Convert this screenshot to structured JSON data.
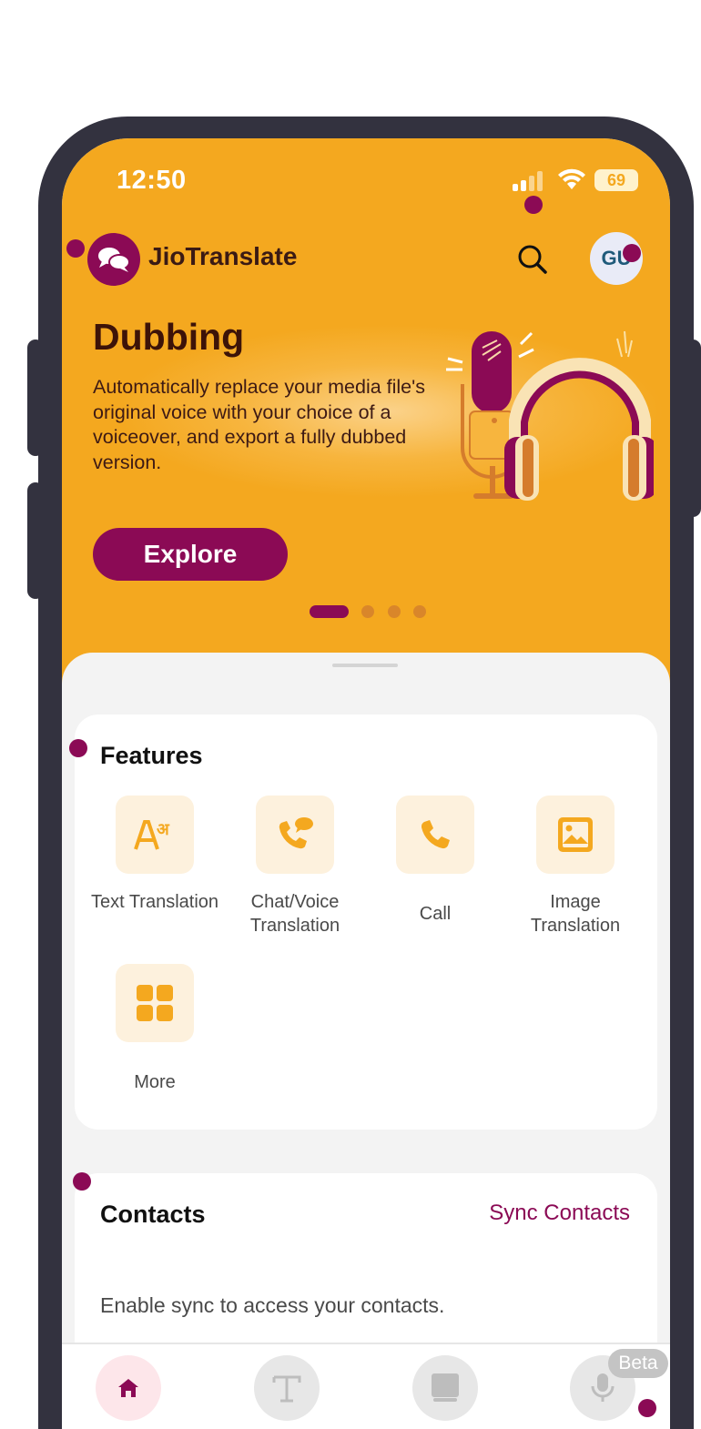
{
  "status_bar": {
    "time": "12:50",
    "battery": "69"
  },
  "header": {
    "app_name": "JioTranslate",
    "avatar_initials": "GU"
  },
  "hero": {
    "title": "Dubbing",
    "description": "Automatically replace your media file's original voice with your choice of a voiceover, and export a fully dubbed version.",
    "cta": "Explore",
    "carousel_active_index": 0,
    "carousel_count": 4
  },
  "features": {
    "title": "Features",
    "items": [
      {
        "label": "Text Translation",
        "icon": "text-translate-icon"
      },
      {
        "label": "Chat/Voice Translation",
        "icon": "chat-voice-icon"
      },
      {
        "label": "Call",
        "icon": "phone-icon"
      },
      {
        "label": "Image Translation",
        "icon": "image-icon"
      },
      {
        "label": "More",
        "icon": "grid-icon"
      }
    ]
  },
  "contacts": {
    "title": "Contacts",
    "sync_label": "Sync Contacts",
    "message": "Enable sync to access your contacts."
  },
  "bottom_nav": {
    "items": [
      {
        "icon": "home-icon",
        "active": true
      },
      {
        "icon": "text-icon",
        "active": false
      },
      {
        "icon": "book-icon",
        "active": false
      },
      {
        "icon": "mic-icon",
        "active": false
      }
    ],
    "beta_label": "Beta"
  },
  "colors": {
    "brand": "#8b0a55",
    "hero": "#f4a81f",
    "feature_tile": "#fdf1dd"
  }
}
